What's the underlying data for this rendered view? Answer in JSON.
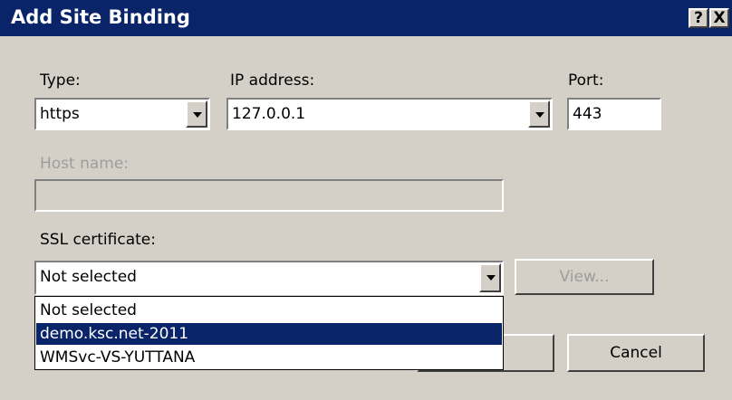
{
  "dialog": {
    "title": "Add Site Binding",
    "help_glyph": "?",
    "close_glyph": "X"
  },
  "form": {
    "type_label": "Type:",
    "type_value": "https",
    "ip_label": "IP address:",
    "ip_value": "127.0.0.1",
    "port_label": "Port:",
    "port_value": "443",
    "host_label": "Host name:",
    "host_value": "",
    "ssl_label": "SSL certificate:",
    "ssl_value": "Not selected",
    "view_button": "View..."
  },
  "ssl_dropdown": {
    "options": [
      "Not selected",
      "demo.ksc.net-2011",
      "WMSvc-VS-YUTTANA"
    ],
    "highlighted_index": 1
  },
  "buttons": {
    "ok": "",
    "cancel": "Cancel"
  },
  "colors": {
    "titlebar": "#0a246a",
    "dialog_bg": "#d4d0c8",
    "selection": "#0a246a"
  }
}
